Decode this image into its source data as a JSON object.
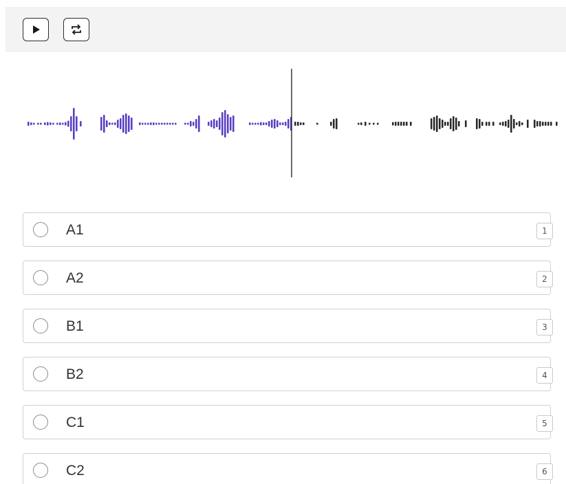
{
  "toolbar": {
    "play_icon": "play-icon",
    "loop_icon": "loop-icon"
  },
  "waveform": {
    "played_color": "#5b3fc4",
    "unplayed_color": "#2b2b2b",
    "cursor_color": "#2b2b2b"
  },
  "options": [
    {
      "label": "A1",
      "hotkey": "1"
    },
    {
      "label": "A2",
      "hotkey": "2"
    },
    {
      "label": "B1",
      "hotkey": "3"
    },
    {
      "label": "B2",
      "hotkey": "4"
    },
    {
      "label": "C1",
      "hotkey": "5"
    },
    {
      "label": "C2",
      "hotkey": "6"
    }
  ]
}
